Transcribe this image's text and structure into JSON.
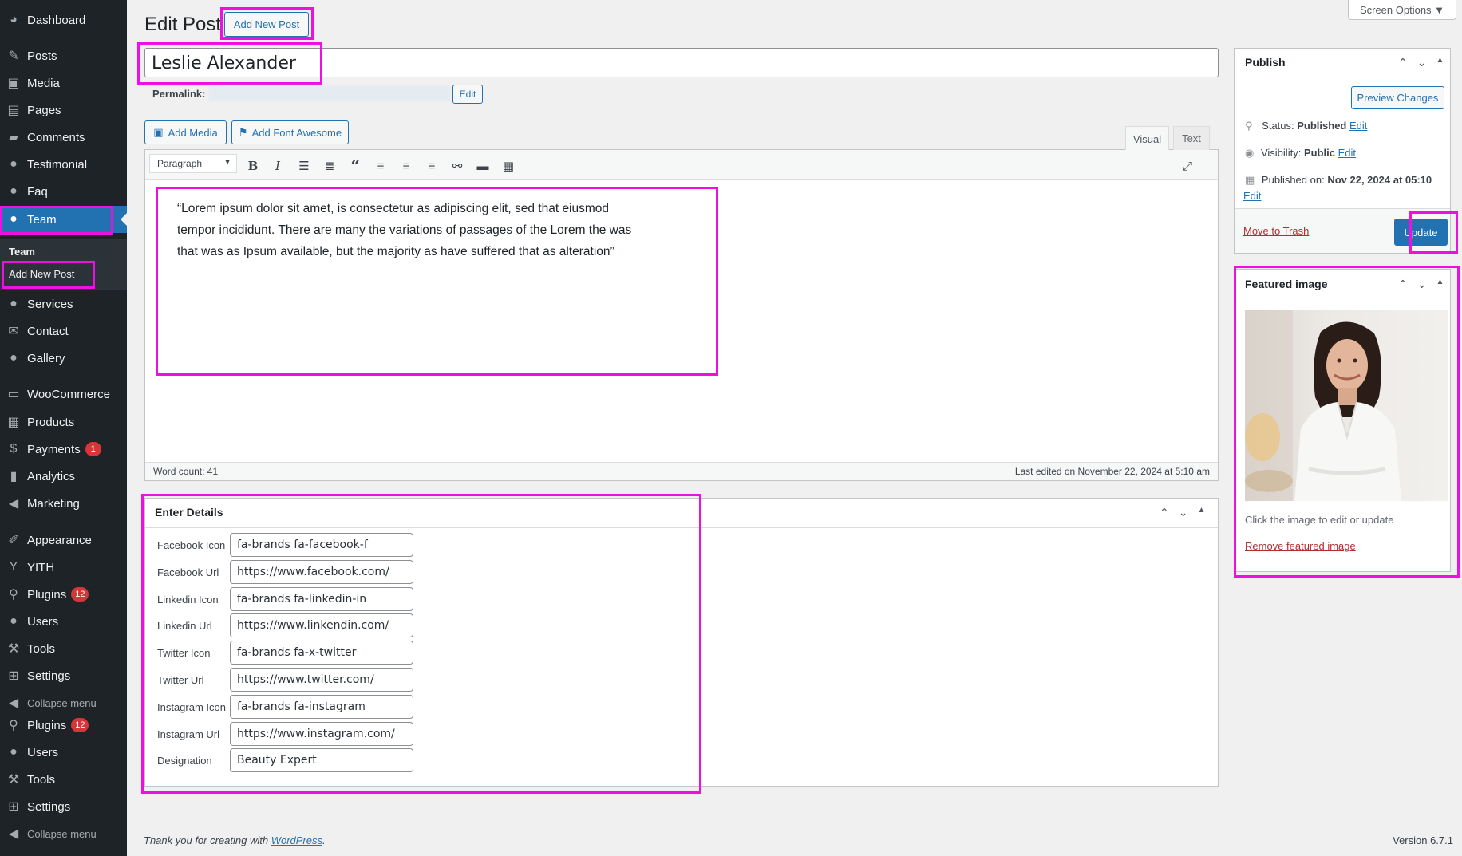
{
  "sidebar": {
    "items": [
      {
        "icon": "dashboard-icon",
        "glyph": "◕",
        "label": "Dashboard",
        "badge": ""
      },
      {
        "icon": "posts-icon",
        "glyph": "✎",
        "label": "Posts",
        "badge": ""
      },
      {
        "icon": "media-icon",
        "glyph": "▣",
        "label": "Media",
        "badge": ""
      },
      {
        "icon": "pages-icon",
        "glyph": "▤",
        "label": "Pages",
        "badge": ""
      },
      {
        "icon": "comments-icon",
        "glyph": "▰",
        "label": "Comments",
        "badge": ""
      },
      {
        "icon": "user-icon",
        "glyph": "●",
        "label": "Testimonial",
        "badge": ""
      },
      {
        "icon": "user-icon",
        "glyph": "●",
        "label": "Faq",
        "badge": ""
      },
      {
        "icon": "user-icon",
        "glyph": "●",
        "label": "Team",
        "badge": ""
      },
      {
        "icon": "user-icon",
        "glyph": "●",
        "label": "Services",
        "badge": ""
      },
      {
        "icon": "mail-icon",
        "glyph": "✉",
        "label": "Contact",
        "badge": ""
      },
      {
        "icon": "user-icon",
        "glyph": "●",
        "label": "Gallery",
        "badge": ""
      },
      {
        "icon": "woocommerce-icon",
        "glyph": "▭",
        "label": "WooCommerce",
        "badge": ""
      },
      {
        "icon": "archive-icon",
        "glyph": "▦",
        "label": "Products",
        "badge": ""
      },
      {
        "icon": "payments-icon",
        "glyph": "$",
        "label": "Payments",
        "badge": "1"
      },
      {
        "icon": "analytics-icon",
        "glyph": "▮",
        "label": "Analytics",
        "badge": ""
      },
      {
        "icon": "megaphone-icon",
        "glyph": "◀",
        "label": "Marketing",
        "badge": ""
      },
      {
        "icon": "brush-icon",
        "glyph": "✐",
        "label": "Appearance",
        "badge": ""
      },
      {
        "icon": "yith-icon",
        "glyph": "Y",
        "label": "YITH",
        "badge": ""
      },
      {
        "icon": "plugin-icon",
        "glyph": "⚲",
        "label": "Plugins",
        "badge": "12"
      },
      {
        "icon": "user-icon",
        "glyph": "●",
        "label": "Users",
        "badge": ""
      },
      {
        "icon": "wrench-icon",
        "glyph": "⚒",
        "label": "Tools",
        "badge": ""
      },
      {
        "icon": "settings-icon",
        "glyph": "⊞",
        "label": "Settings",
        "badge": ""
      },
      {
        "icon": "collapse-icon",
        "glyph": "◀",
        "label": "Collapse menu",
        "badge": ""
      },
      {
        "icon": "plugin-icon",
        "glyph": "⚲",
        "label": "Plugins",
        "badge": "12"
      },
      {
        "icon": "user-icon",
        "glyph": "●",
        "label": "Users",
        "badge": ""
      },
      {
        "icon": "wrench-icon",
        "glyph": "⚒",
        "label": "Tools",
        "badge": ""
      },
      {
        "icon": "settings-icon",
        "glyph": "⊞",
        "label": "Settings",
        "badge": ""
      },
      {
        "icon": "collapse-icon",
        "glyph": "◀",
        "label": "Collapse menu",
        "badge": ""
      }
    ],
    "submenu": {
      "title": "Team",
      "item": "Add New Post"
    }
  },
  "header": {
    "title": "Edit Post",
    "add_new": "Add New Post",
    "screen_options": "Screen Options ▼"
  },
  "post": {
    "title_value": "Leslie Alexander",
    "permalink_label": "Permalink:",
    "permalink_edit": "Edit"
  },
  "editor": {
    "add_media": "Add Media",
    "add_font_awesome": "Add Font Awesome",
    "tab_visual": "Visual",
    "tab_text": "Text",
    "format_select": "Paragraph",
    "content": "“Lorem ipsum dolor sit amet, is consectetur as adipiscing elit, sed that eiusmod tempor incididunt. There are many the variations of passages of the Lorem the was that was as Ipsum available, but the majority as have suffered that as alteration”",
    "word_count": "Word count: 41",
    "last_edited": "Last edited on November 22, 2024 at 5:10 am"
  },
  "details": {
    "title": "Enter Details",
    "fields": [
      {
        "label": "Facebook Icon",
        "value": "fa-brands fa-facebook-f"
      },
      {
        "label": "Facebook Url",
        "value": "https://www.facebook.com/"
      },
      {
        "label": "Linkedin Icon",
        "value": "fa-brands fa-linkedin-in"
      },
      {
        "label": "Linkedin Url",
        "value": "https://www.linkendin.com/"
      },
      {
        "label": "Twitter Icon",
        "value": "fa-brands fa-x-twitter"
      },
      {
        "label": "Twitter Url",
        "value": "https://www.twitter.com/"
      },
      {
        "label": "Instagram Icon",
        "value": "fa-brands fa-instagram"
      },
      {
        "label": "Instagram Url",
        "value": "https://www.instagram.com/"
      },
      {
        "label": "Designation",
        "value": "Beauty Expert"
      }
    ]
  },
  "publish": {
    "title": "Publish",
    "preview": "Preview Changes",
    "status_label": "Status:",
    "status_value": "Published",
    "visibility_label": "Visibility:",
    "visibility_value": "Public",
    "published_label": "Published on:",
    "published_value": "Nov 22, 2024 at 05:10",
    "edit": "Edit",
    "trash": "Move to Trash",
    "update": "Update"
  },
  "featured": {
    "title": "Featured image",
    "hint": "Click the image to edit or update",
    "remove": "Remove featured image"
  },
  "footer": {
    "thanks": "Thank you for creating with",
    "wp_link": "WordPress",
    "period": ".",
    "version": "Version 6.7.1"
  },
  "colors": {
    "accent": "#2271b1",
    "highlight": "#ee10e0",
    "sidebar": "#1d2327",
    "danger": "#d63638"
  }
}
